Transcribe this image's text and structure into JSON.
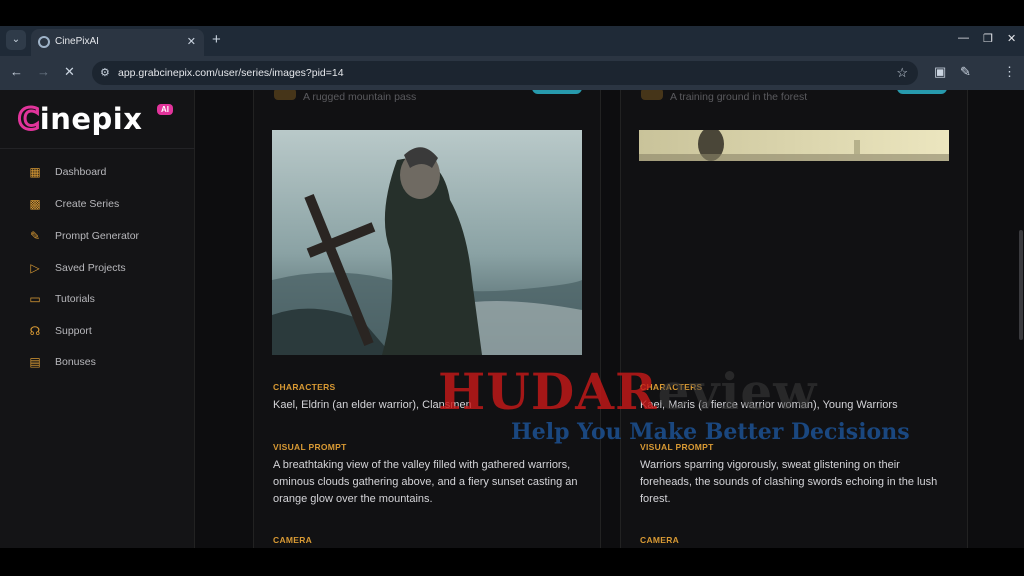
{
  "browser": {
    "tab_title": "CinePixAI",
    "url": "app.grabcinepix.com/user/series/images?pid=14"
  },
  "brand": {
    "logo_text": "inepix",
    "logo_initial": "C",
    "badge": "AI",
    "accent_color": "#e2349b",
    "icon_color": "#d99a34"
  },
  "sidebar": {
    "items": [
      {
        "label": "Dashboard",
        "icon": "grid-icon"
      },
      {
        "label": "Create Series",
        "icon": "film-icon"
      },
      {
        "label": "Prompt Generator",
        "icon": "edit-icon"
      },
      {
        "label": "Saved Projects",
        "icon": "video-icon"
      },
      {
        "label": "Tutorials",
        "icon": "book-icon"
      },
      {
        "label": "Support",
        "icon": "headset-icon"
      },
      {
        "label": "Bonuses",
        "icon": "gift-icon"
      }
    ]
  },
  "cards": [
    {
      "location": "A rugged mountain pass",
      "characters_label": "CHARACTERS",
      "characters": "Kael, Eldrin (an elder warrior), Clansmen",
      "visual_prompt_label": "VISUAL PROMPT",
      "visual_prompt": "A breathtaking view of the valley filled with gathered warriors, ominous clouds gathering above, and a fiery sunset casting an orange glow over the mountains.",
      "camera_label": "CAMERA"
    },
    {
      "location": "A training ground in the forest",
      "characters_label": "CHARACTERS",
      "characters": "Kael, Maris (a fierce warrior woman), Young Warriors",
      "visual_prompt_label": "VISUAL PROMPT",
      "visual_prompt": "Warriors sparring vigorously, sweat glistening on their foreheads, the sounds of clashing swords echoing in the lush forest.",
      "camera_label": "CAMERA"
    }
  ],
  "watermark": {
    "title_main": "HUDAR",
    "title_tail": "eview",
    "tagline": "Help You Make Better Decisions"
  }
}
